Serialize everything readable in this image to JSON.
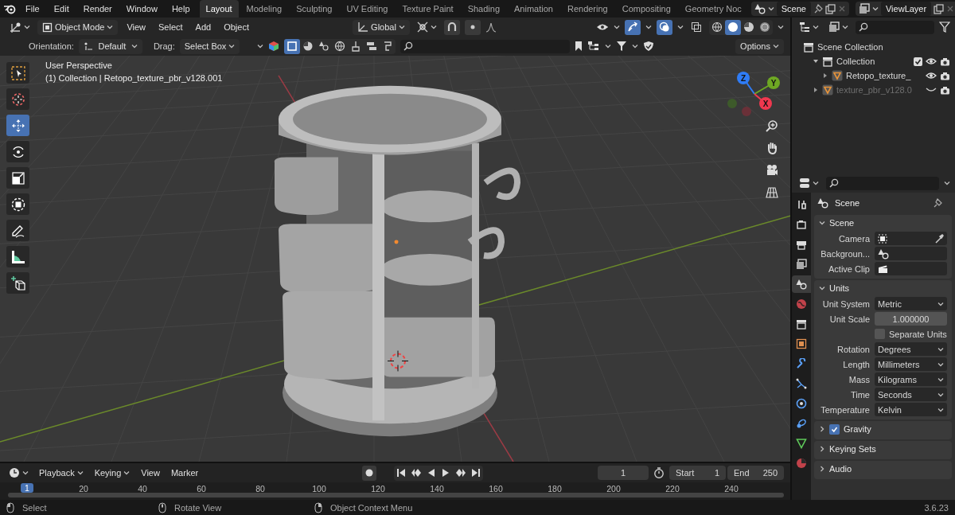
{
  "menu": [
    "File",
    "Edit",
    "Render",
    "Window",
    "Help"
  ],
  "workspaces": [
    {
      "label": "Layout",
      "selected": true
    },
    {
      "label": "Modeling",
      "selected": false
    },
    {
      "label": "Sculpting",
      "selected": false
    },
    {
      "label": "UV Editing",
      "selected": false
    },
    {
      "label": "Texture Paint",
      "selected": false
    },
    {
      "label": "Shading",
      "selected": false
    },
    {
      "label": "Animation",
      "selected": false
    },
    {
      "label": "Rendering",
      "selected": false
    },
    {
      "label": "Compositing",
      "selected": false
    },
    {
      "label": "Geometry Noc",
      "selected": false
    }
  ],
  "scene": {
    "name": "Scene"
  },
  "view_layer": {
    "name": "ViewLayer"
  },
  "viewport_header": {
    "mode": "Object Mode",
    "menus": [
      "View",
      "Select",
      "Add",
      "Object"
    ],
    "orientation": "Global",
    "toggles": [
      {
        "kind": "snap",
        "on": false
      },
      {
        "kind": "proportional",
        "on": false
      },
      {
        "kind": "gizmos",
        "on": true
      },
      {
        "kind": "overlays",
        "on": true
      },
      {
        "kind": "xray",
        "on": false
      }
    ],
    "shading": [
      {
        "kind": "wireframe",
        "selected": false
      },
      {
        "kind": "solid",
        "selected": true
      },
      {
        "kind": "material",
        "selected": false
      },
      {
        "kind": "rendered",
        "selected": false
      }
    ]
  },
  "tool_settings": {
    "orientation_label": "Orientation:",
    "orientation": "Default",
    "drag_label": "Drag:",
    "drag": "Select Box",
    "options": "Options",
    "filters": [
      {
        "kind": "square",
        "selected": true
      },
      {
        "kind": "pie",
        "selected": false
      },
      {
        "kind": "shapes",
        "selected": false
      },
      {
        "kind": "globe",
        "selected": false
      },
      {
        "kind": "brush",
        "selected": false
      },
      {
        "kind": "stack",
        "selected": false
      },
      {
        "kind": "bucket",
        "selected": false
      }
    ]
  },
  "tools": [
    {
      "kind": "select_box",
      "selected": false
    },
    {
      "kind": "cursor",
      "selected": false
    },
    {
      "kind": "move",
      "selected": true
    },
    {
      "kind": "rotate",
      "selected": false
    },
    {
      "kind": "scale",
      "selected": false
    },
    {
      "kind": "transform",
      "selected": false
    },
    {
      "kind": "annotate",
      "selected": false
    },
    {
      "kind": "measure",
      "selected": false
    },
    {
      "kind": "add_cube",
      "selected": false
    }
  ],
  "viewport_info": [
    "User Perspective",
    "(1) Collection | Retopo_texture_pbr_v128.001"
  ],
  "gizmo_axes": [
    {
      "label": "Z",
      "color": "#2f7cf6"
    },
    {
      "label": "Y",
      "color": "#6ea823"
    },
    {
      "label": "X",
      "color": "#f0384f"
    }
  ],
  "outliner": [
    {
      "label": "Scene Collection",
      "kind": "scene_collection",
      "children": [
        {
          "label": "Collection",
          "kind": "collection",
          "expanded": true,
          "checked": true,
          "visible": true,
          "children": [
            {
              "label": "Retopo_texture_",
              "kind": "mesh",
              "expanded": false,
              "visible": true
            }
          ]
        },
        {
          "label": "texture_pbr_v128.0",
          "kind": "mesh",
          "expanded": false,
          "visible": false
        }
      ]
    }
  ],
  "properties": {
    "tabs": [
      {
        "kind": "tool",
        "selected": false
      },
      {
        "kind": "render",
        "selected": false
      },
      {
        "kind": "output",
        "selected": false
      },
      {
        "kind": "view_layer",
        "selected": false
      },
      {
        "kind": "scene",
        "selected": true
      },
      {
        "kind": "world",
        "selected": false
      },
      {
        "kind": "collection",
        "selected": false
      },
      {
        "kind": "object",
        "selected": false
      },
      {
        "kind": "modifiers",
        "selected": false
      },
      {
        "kind": "particles",
        "selected": false
      },
      {
        "kind": "physics",
        "selected": false
      },
      {
        "kind": "constraints",
        "selected": false
      },
      {
        "kind": "data",
        "selected": false
      },
      {
        "kind": "material",
        "selected": false
      }
    ],
    "context": "Scene",
    "panels": [
      {
        "title": "Scene",
        "kind": "plain",
        "expanded": true,
        "rows": [
          {
            "kind": "camera",
            "label": "Camera"
          },
          {
            "kind": "scene",
            "label": "Backgroun..."
          },
          {
            "kind": "clip",
            "label": "Active Clip"
          }
        ]
      },
      {
        "title": "Units",
        "kind": "plain",
        "expanded": true,
        "rows": [
          {
            "kind": "dropdown",
            "label": "Unit System",
            "value": "Metric"
          },
          {
            "kind": "number",
            "label": "Unit Scale",
            "value": "1.000000"
          },
          {
            "kind": "checkbox",
            "label": "Separate Units",
            "checked": false
          },
          {
            "kind": "dropdown",
            "label": "Rotation",
            "value": "Degrees"
          },
          {
            "kind": "dropdown",
            "label": "Length",
            "value": "Millimeters"
          },
          {
            "kind": "dropdown",
            "label": "Mass",
            "value": "Kilograms"
          },
          {
            "kind": "dropdown",
            "label": "Time",
            "value": "Seconds"
          },
          {
            "kind": "dropdown",
            "label": "Temperature",
            "value": "Kelvin"
          }
        ]
      },
      {
        "title": "Gravity",
        "kind": "toggle",
        "checked": true,
        "expanded": false
      },
      {
        "title": "Keying Sets",
        "kind": "plain",
        "expanded": false
      },
      {
        "title": "Audio",
        "kind": "plain",
        "expanded": false
      }
    ]
  },
  "timeline": {
    "menus": [
      {
        "label": "Playback",
        "kind": "dropdown"
      },
      {
        "label": "Keying",
        "kind": "dropdown"
      },
      {
        "label": "View",
        "kind": "plain"
      },
      {
        "label": "Marker",
        "kind": "plain"
      }
    ],
    "current_frame": "1",
    "start_label": "Start",
    "start": "1",
    "end_label": "End",
    "end": "250",
    "ruler_current": "1",
    "ruler_labels": [
      "20",
      "40",
      "60",
      "80",
      "100",
      "120",
      "140",
      "160",
      "180",
      "200",
      "220",
      "240"
    ]
  },
  "status_bar": {
    "hints": [
      {
        "kind": "left_click",
        "text": "Select"
      },
      {
        "kind": "middle_click",
        "text": "Rotate View"
      },
      {
        "kind": "right_click",
        "text": "Object Context Menu"
      }
    ],
    "version": "3.6.23"
  }
}
